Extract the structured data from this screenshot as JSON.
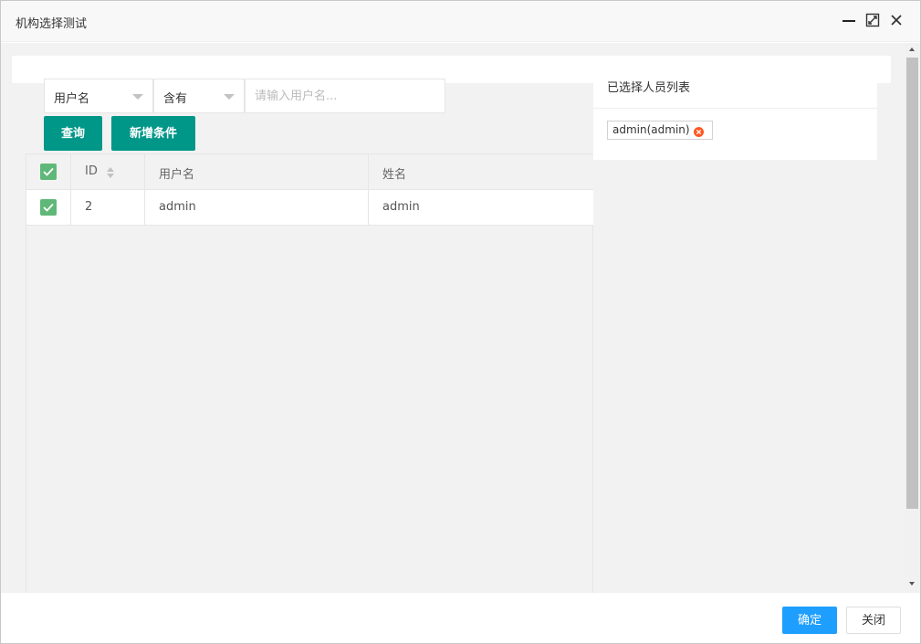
{
  "dialog": {
    "title": "机构选择测试"
  },
  "search": {
    "field_value": "用户名",
    "operator_value": "含有",
    "input_value": "",
    "input_placeholder": "请输入用户名...",
    "query_label": "查询",
    "add_condition_label": "新增条件"
  },
  "table": {
    "columns": [
      "ID",
      "用户名",
      "姓名"
    ],
    "rows": [
      {
        "id": "2",
        "username": "admin",
        "name": "admin",
        "checked": true
      }
    ]
  },
  "selected_panel": {
    "title": "已选择人员列表",
    "tags": [
      "admin(admin)"
    ]
  },
  "footer": {
    "ok_label": "确定",
    "close_label": "关闭"
  },
  "colors": {
    "primary_green": "#009688",
    "checkbox_green": "#5fb878",
    "primary_blue": "#1e9fff",
    "tag_remove_red": "#ff5722"
  }
}
